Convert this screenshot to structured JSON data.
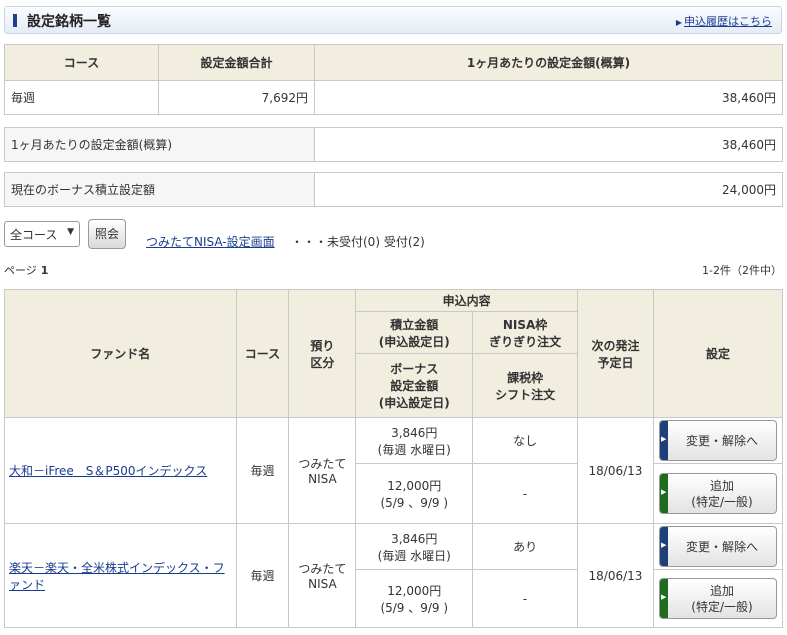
{
  "header": {
    "title": "設定銘柄一覧",
    "history_link": "申込履歴はこちら"
  },
  "summary": {
    "headers": [
      "コース",
      "設定金額合計",
      "1ヶ月あたりの設定金額(概算)"
    ],
    "row": {
      "course": "毎週",
      "total": "7,692円",
      "monthly": "38,460円"
    }
  },
  "monthly_estimate": {
    "label": "1ヶ月あたりの設定金額(概算)",
    "value": "38,460円"
  },
  "bonus": {
    "label": "現在のボーナス積立設定額",
    "value": "24,000円"
  },
  "controls": {
    "course_select": "全コース",
    "search_button": "照会",
    "nisa_link": "つみたてNISA-設定画面",
    "status_text": "・・・未受付(0) 受付(2)"
  },
  "pagination": {
    "page_label": "ページ",
    "page_number": "1",
    "count_text": "1-2件（2件中）"
  },
  "fund_table": {
    "headers": {
      "fund_name": "ファンド名",
      "course": "コース",
      "custody_1": "預り",
      "custody_2": "区分",
      "application": "申込内容",
      "amount_1": "積立金額",
      "amount_2": "(申込設定日)",
      "nisa_1": "NISA枠",
      "nisa_2": "ぎりぎり注文",
      "bonus_1": "ボーナス",
      "bonus_2": "設定金額",
      "bonus_3": "(申込設定日)",
      "tax_1": "課税枠",
      "tax_2": "シフト注文",
      "next_1": "次の発注",
      "next_2": "予定日",
      "settings": "設定"
    },
    "rows": [
      {
        "fund_name": "大和－iFree　S＆P500インデックス",
        "course": "毎週",
        "custody_1": "つみたて",
        "custody_2": "NISA",
        "amount": "3,846円",
        "amount_date": "(毎週 水曜日)",
        "nisa_order": "なし",
        "bonus_amount": "12,000円",
        "bonus_date": "(5/9 、9/9 )",
        "tax_shift": "-",
        "next_date": "18/06/13",
        "change_button": "変更・解除へ",
        "add_button_1": "追加",
        "add_button_2": "(特定/一般)"
      },
      {
        "fund_name": "楽天－楽天・全米株式インデックス・ファンド",
        "course": "毎週",
        "custody_1": "つみたて",
        "custody_2": "NISA",
        "amount": "3,846円",
        "amount_date": "(毎週 水曜日)",
        "nisa_order": "あり",
        "bonus_amount": "12,000円",
        "bonus_date": "(5/9 、9/9 )",
        "tax_shift": "-",
        "next_date": "18/06/13",
        "change_button": "変更・解除へ",
        "add_button_1": "追加",
        "add_button_2": "(特定/一般)"
      }
    ]
  },
  "colors": {
    "change_button_side": "#1d3f7a",
    "add_button_side": "#1f6b1f",
    "header_bg": "#f1eedf",
    "link": "#1a3c8f"
  },
  "icons": {
    "title_marker": "header-bar-icon",
    "link_arrow": "arrow-right-icon",
    "dropdown": "chevron-down-icon",
    "button_arrow": "triangle-right-icon"
  }
}
